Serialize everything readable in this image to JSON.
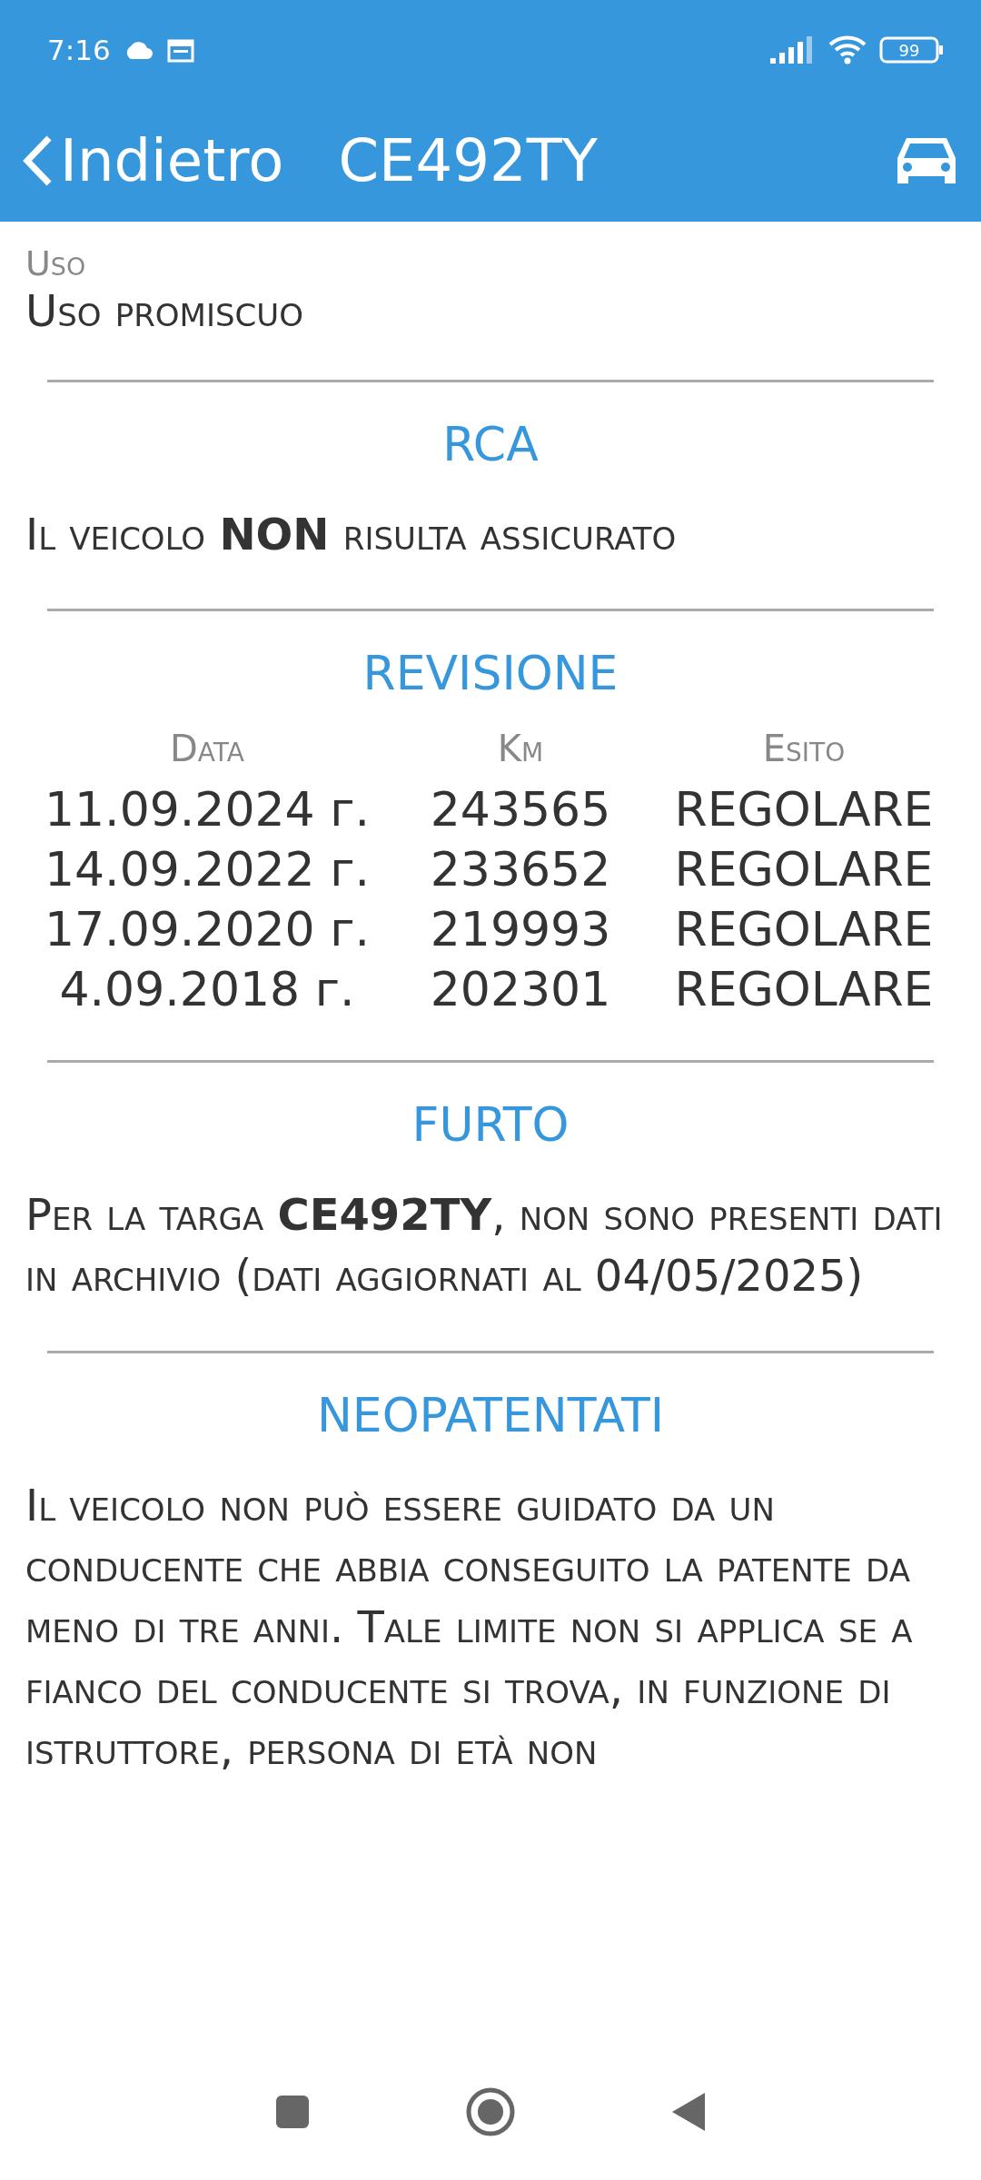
{
  "status_bar": {
    "time": "7:16",
    "battery": "99"
  },
  "header": {
    "back_label": "Indietro",
    "title": "CE492TY"
  },
  "usage": {
    "label": "Uso",
    "value": "Uso promiscuo"
  },
  "sections": [
    {
      "kind": "text",
      "title": "RCA",
      "text": "Il veicolo **NON** risulta assicurato"
    },
    {
      "kind": "table",
      "title": "REVISIONE",
      "columns": [
        "Data",
        "Km",
        "Esito"
      ],
      "rows": [
        [
          "11.09.2024 г.",
          "243565",
          "REGOLARE"
        ],
        [
          "14.09.2022 г.",
          "233652",
          "REGOLARE"
        ],
        [
          "17.09.2020 г.",
          "219993",
          "REGOLARE"
        ],
        [
          "4.09.2018 г.",
          "202301",
          "REGOLARE"
        ]
      ]
    },
    {
      "kind": "text",
      "title": "FURTO",
      "text": "Per la targa **CE492TY**, non sono presenti dati in archivio (dati aggiornati al 04/05/2025)"
    },
    {
      "kind": "text",
      "title": "NEOPATENTATI",
      "text": "Il veicolo non può essere guidato da un conducente che abbia conseguito la patente da meno di tre anni. Tale limite non si applica se a fianco del conducente si trova, in funzione di istruttore, persona di età non"
    }
  ]
}
